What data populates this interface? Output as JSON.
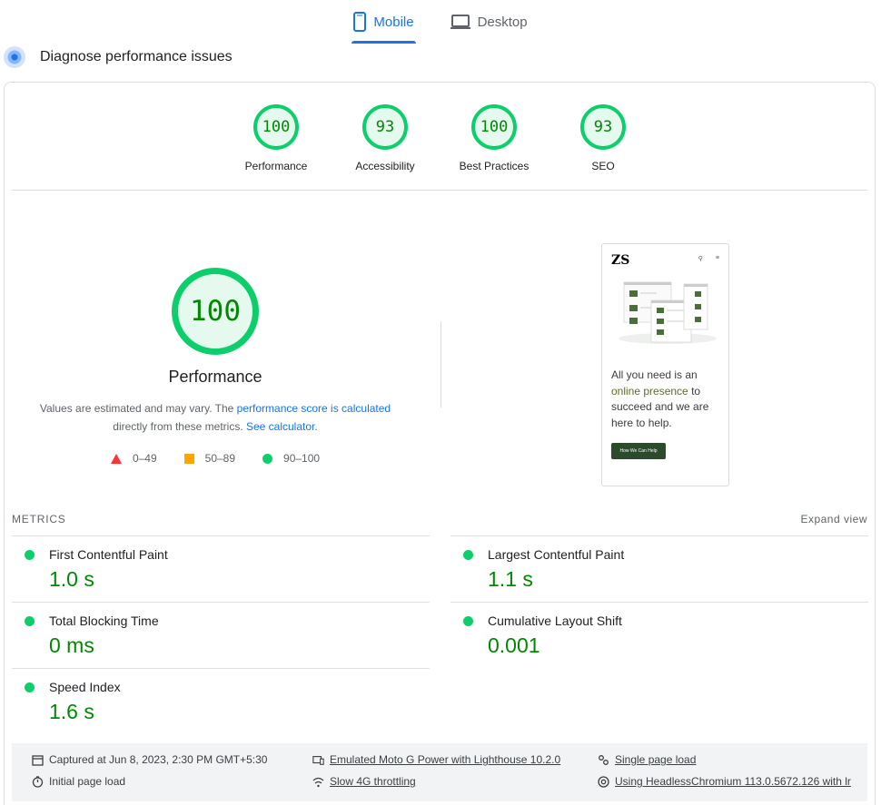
{
  "tabs": [
    {
      "label": "Mobile",
      "icon": "mobile-icon",
      "active": true
    },
    {
      "label": "Desktop",
      "icon": "desktop-icon",
      "active": false
    }
  ],
  "diagnose": {
    "title": "Diagnose performance issues"
  },
  "gauges": [
    {
      "score": "100",
      "label": "Performance"
    },
    {
      "score": "93",
      "label": "Accessibility"
    },
    {
      "score": "100",
      "label": "Best Practices"
    },
    {
      "score": "93",
      "label": "SEO"
    }
  ],
  "performance": {
    "score": "100",
    "title": "Performance",
    "note_prefix": "Values are estimated and may vary. The ",
    "note_link": "performance score is calculated",
    "note_mid": "directly from these metrics. ",
    "calc_link": "See calculator",
    "note_end": ".",
    "legend": [
      {
        "range": "0–49",
        "shape": "triangle",
        "color": "#ff3333"
      },
      {
        "range": "50–89",
        "shape": "square",
        "color": "#ffa400"
      },
      {
        "range": "90–100",
        "shape": "circle",
        "color": "#0cce6b"
      }
    ]
  },
  "screenshot": {
    "logo": "ZS",
    "text_1": "All you need is an",
    "text_highlight": "online presence",
    "text_2": " to succeed and we are here to help.",
    "button": "How We Can Help"
  },
  "metrics": {
    "heading": "METRICS",
    "expand": "Expand view",
    "items": [
      {
        "name": "First Contentful Paint",
        "value": "1.0 s"
      },
      {
        "name": "Largest Contentful Paint",
        "value": "1.1 s"
      },
      {
        "name": "Total Blocking Time",
        "value": "0 ms"
      },
      {
        "name": "Cumulative Layout Shift",
        "value": "0.001"
      },
      {
        "name": "Speed Index",
        "value": "1.6 s"
      }
    ]
  },
  "footer": {
    "captured": "Captured at Jun 8, 2023, 2:30 PM GMT+5:30",
    "emulated": "Emulated Moto G Power with Lighthouse 10.2.0",
    "single_load": "Single page load",
    "initial_load": "Initial page load",
    "throttling": "Slow 4G throttling",
    "browser": "Using HeadlessChromium 113.0.5672.126 with lr"
  },
  "colors": {
    "good": "#0cce6b",
    "good_text": "#008800",
    "accent": "#1a73e8"
  }
}
